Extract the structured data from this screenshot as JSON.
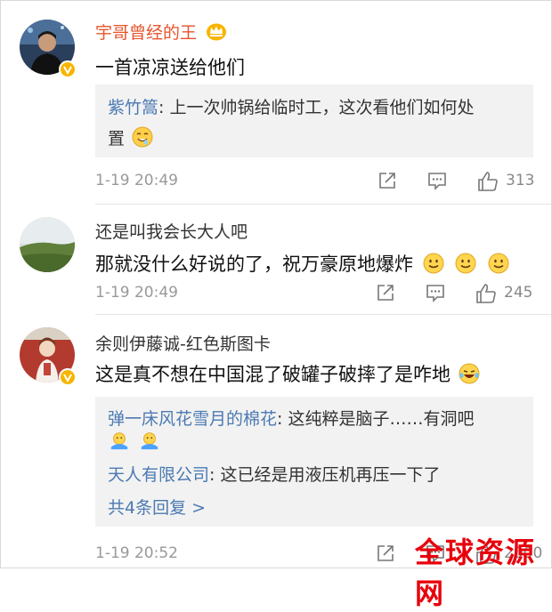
{
  "comments": [
    {
      "name": "宇哥曾经的王",
      "text": "一首凉凉送给他们",
      "quote_name": "紫竹篙",
      "quote_text_1": ": 上一次帅锅给临时工，这次看他们如何处",
      "quote_text_2": "置",
      "time": "1-19 20:49",
      "likes": "313"
    },
    {
      "name": "还是叫我会长大人吧",
      "text": "那就没什么好说的了，祝万豪原地爆炸",
      "time": "1-19 20:49",
      "likes": "245"
    },
    {
      "name": "余则伊藤诚-红色斯图卡",
      "text": "这是真不想在中国混了破罐子破摔了是咋地",
      "replies": [
        {
          "name": "弹一床风花雪月的棉花",
          "text": ": 这纯粹是脑子……有洞吧"
        },
        {
          "name": "天人有限公司",
          "text": ": 这已经是用液压机再压一下了"
        }
      ],
      "more_replies": "共4条回复 >",
      "time": "1-19 20:52",
      "likes": "2000"
    }
  ],
  "watermark": "全球资源网",
  "icons": [
    "repost-icon",
    "comment-icon",
    "like-icon",
    "verified-badge-icon",
    "crown-icon"
  ],
  "colors": {
    "vip_name": "#e8542b",
    "link": "#4b7ab3",
    "badge": "#f7b500"
  }
}
